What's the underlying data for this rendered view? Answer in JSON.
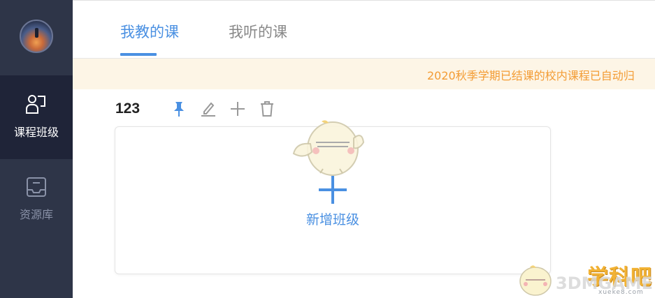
{
  "sidebar": {
    "items": [
      {
        "label": "课程班级",
        "icon": "class-icon",
        "active": true
      },
      {
        "label": "资源库",
        "icon": "inbox-icon",
        "active": false
      }
    ]
  },
  "tabs": [
    {
      "label": "我教的课",
      "active": true
    },
    {
      "label": "我听的课",
      "active": false
    }
  ],
  "banner": {
    "text": "2020秋季学期已结课的校内课程已自动归"
  },
  "group": {
    "title": "123",
    "tools": [
      "pin-icon",
      "edit-icon",
      "plus-icon",
      "delete-icon"
    ]
  },
  "card": {
    "add_label": "新增班级"
  },
  "watermark": {
    "cn": "学科吧",
    "en": "3DMGAME",
    "url": "xueke8.com"
  },
  "colors": {
    "accent": "#4a90e2",
    "sidebar_bg": "#2e3548",
    "sidebar_active_bg": "#1f2438",
    "banner_bg": "#fdf5e6",
    "banner_text": "#f39c34"
  }
}
